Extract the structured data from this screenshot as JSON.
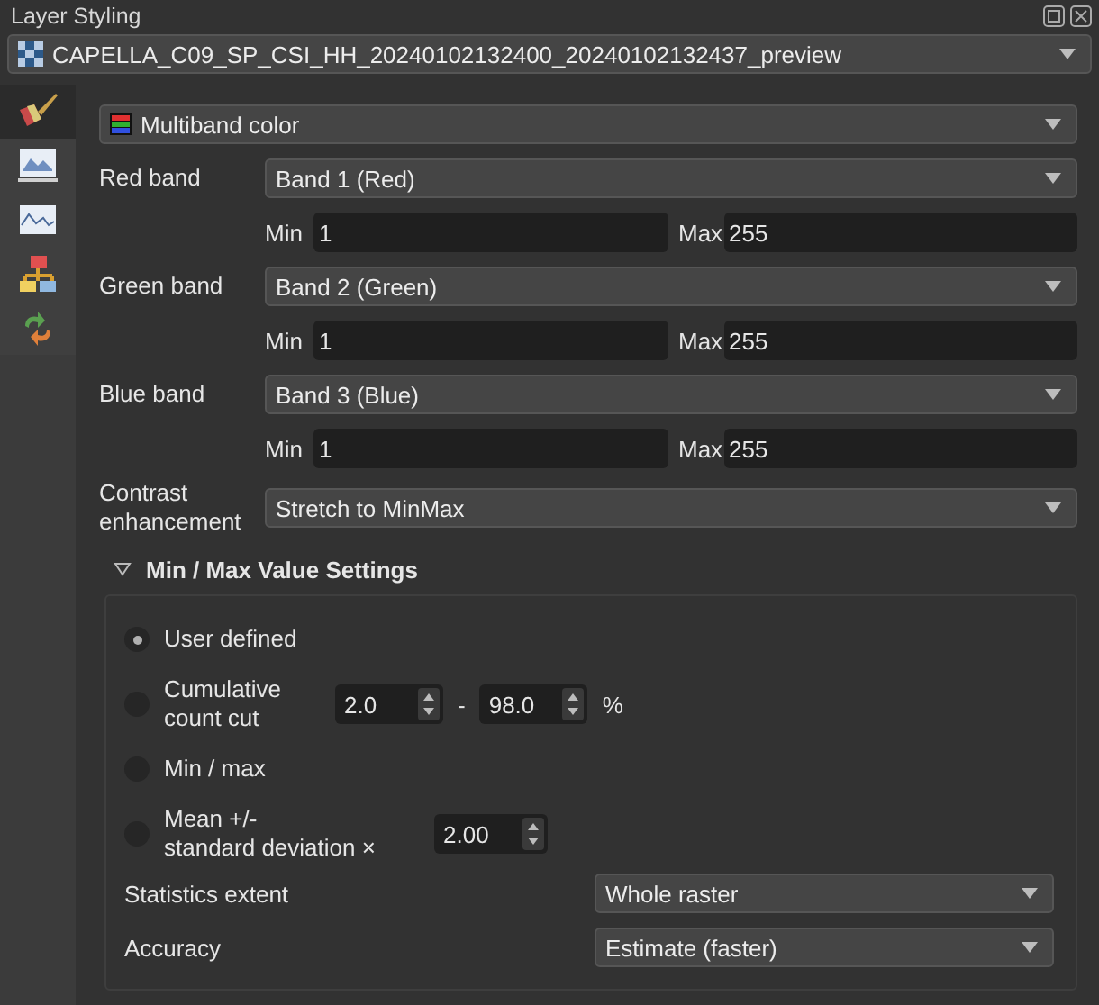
{
  "window": {
    "title": "Layer Styling"
  },
  "layer_select": {
    "value": "CAPELLA_C09_SP_CSI_HH_20240102132400_20240102132437_preview"
  },
  "side_tabs": [
    {
      "kind": "brush",
      "selected": true
    },
    {
      "kind": "image",
      "selected": false
    },
    {
      "kind": "histogram",
      "selected": false
    },
    {
      "kind": "tree",
      "selected": false
    },
    {
      "kind": "history",
      "selected": false
    }
  ],
  "renderer": {
    "value": "Multiband color"
  },
  "bands": [
    {
      "label": "Red band",
      "value": "Band 1 (Red)",
      "min_label": "Min",
      "min": "1",
      "max_label": "Max",
      "max": "255"
    },
    {
      "label": "Green band",
      "value": "Band 2 (Green)",
      "min_label": "Min",
      "min": "1",
      "max_label": "Max",
      "max": "255"
    },
    {
      "label": "Blue band",
      "value": "Band 3 (Blue)",
      "min_label": "Min",
      "min": "1",
      "max_label": "Max",
      "max": "255"
    }
  ],
  "contrast": {
    "label": "Contrast\nenhancement",
    "value": "Stretch to MinMax"
  },
  "minmax_group": {
    "title": "Min / Max Value Settings",
    "expanded": true,
    "options": [
      {
        "kind": "plain",
        "label": "User defined",
        "selected": true
      },
      {
        "kind": "range",
        "label": "Cumulative\ncount cut",
        "from": "2.0",
        "separator": "-",
        "to": "98.0",
        "unit": "%",
        "selected": false
      },
      {
        "kind": "plain",
        "label": "Min / max",
        "selected": false
      },
      {
        "kind": "single",
        "label": "Mean +/-\nstandard deviation ×",
        "value": "2.00",
        "selected": false
      }
    ],
    "settings": [
      {
        "label": "Statistics extent",
        "value": "Whole raster"
      },
      {
        "label": "Accuracy",
        "value": "Estimate (faster)"
      }
    ]
  }
}
